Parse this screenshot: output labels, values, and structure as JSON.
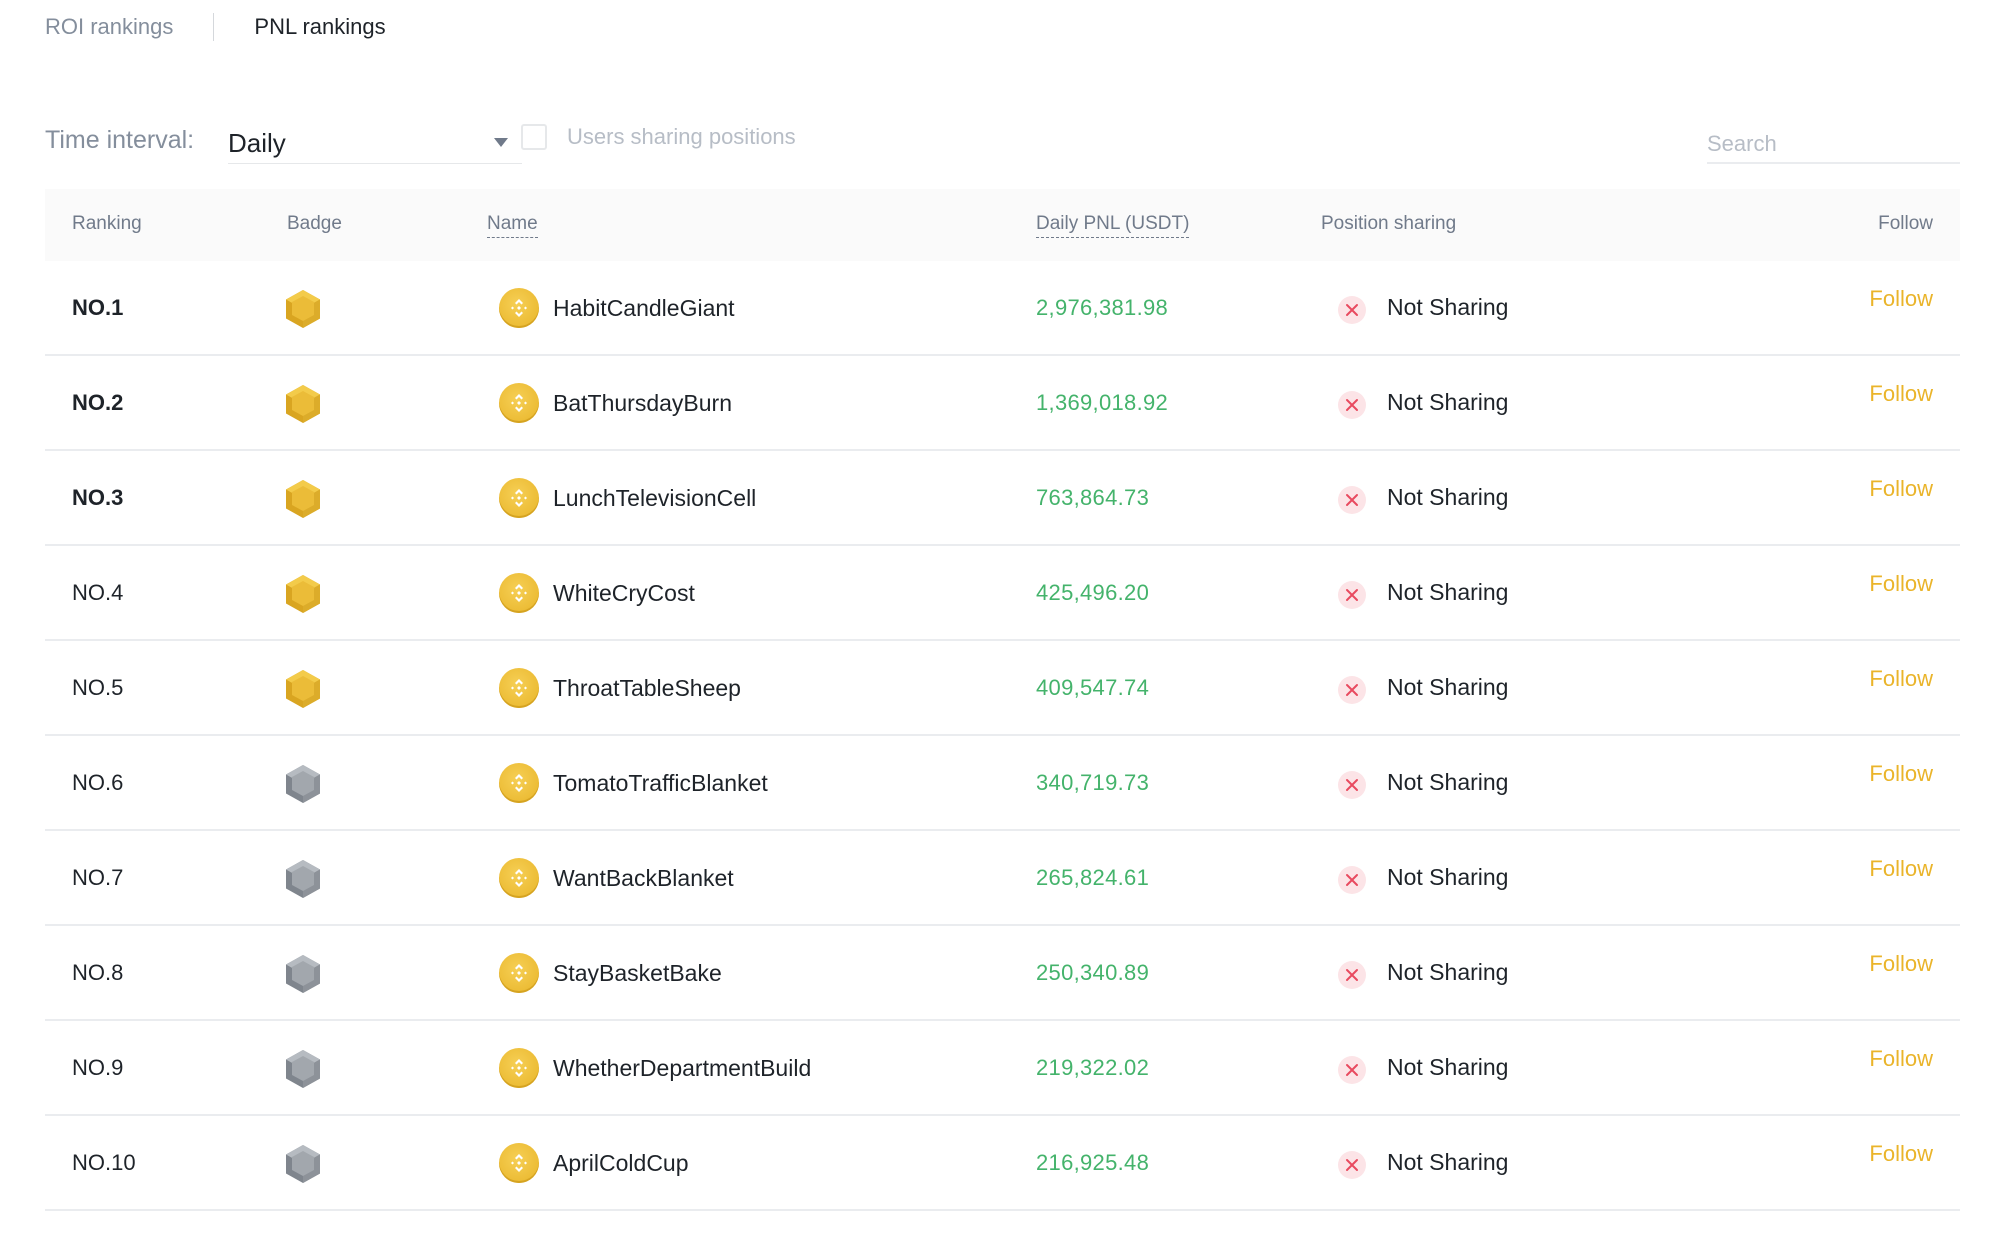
{
  "tabs": [
    {
      "label": "ROI rankings",
      "active": false
    },
    {
      "label": "PNL rankings",
      "active": true
    }
  ],
  "filters": {
    "time_interval_label": "Time interval:",
    "time_interval_value": "Daily",
    "sharing_checkbox_label": "Users sharing positions",
    "sharing_checkbox_checked": false,
    "search_placeholder": "Search",
    "search_value": ""
  },
  "table": {
    "headers": {
      "ranking": "Ranking",
      "badge": "Badge",
      "name": "Name",
      "pnl": "Daily PNL (USDT)",
      "position_sharing": "Position sharing",
      "follow": "Follow"
    },
    "rows": [
      {
        "rank": "NO.1",
        "badge": "gold",
        "name": "HabitCandleGiant",
        "pnl": "2,976,381.98",
        "sharing": "Not Sharing",
        "follow": "Follow"
      },
      {
        "rank": "NO.2",
        "badge": "gold",
        "name": "BatThursdayBurn",
        "pnl": "1,369,018.92",
        "sharing": "Not Sharing",
        "follow": "Follow"
      },
      {
        "rank": "NO.3",
        "badge": "gold",
        "name": "LunchTelevisionCell",
        "pnl": "763,864.73",
        "sharing": "Not Sharing",
        "follow": "Follow"
      },
      {
        "rank": "NO.4",
        "badge": "gold",
        "name": "WhiteCryCost",
        "pnl": "425,496.20",
        "sharing": "Not Sharing",
        "follow": "Follow"
      },
      {
        "rank": "NO.5",
        "badge": "gold",
        "name": "ThroatTableSheep",
        "pnl": "409,547.74",
        "sharing": "Not Sharing",
        "follow": "Follow"
      },
      {
        "rank": "NO.6",
        "badge": "silver",
        "name": "TomatoTrafficBlanket",
        "pnl": "340,719.73",
        "sharing": "Not Sharing",
        "follow": "Follow"
      },
      {
        "rank": "NO.7",
        "badge": "silver",
        "name": "WantBackBlanket",
        "pnl": "265,824.61",
        "sharing": "Not Sharing",
        "follow": "Follow"
      },
      {
        "rank": "NO.8",
        "badge": "silver",
        "name": "StayBasketBake",
        "pnl": "250,340.89",
        "sharing": "Not Sharing",
        "follow": "Follow"
      },
      {
        "rank": "NO.9",
        "badge": "silver",
        "name": "WhetherDepartmentBuild",
        "pnl": "219,322.02",
        "sharing": "Not Sharing",
        "follow": "Follow"
      },
      {
        "rank": "NO.10",
        "badge": "silver",
        "name": "AprilColdCup",
        "pnl": "216,925.48",
        "sharing": "Not Sharing",
        "follow": "Follow"
      }
    ]
  },
  "icons": {
    "gold_badge": "hexagon-gold-badge-icon",
    "silver_badge": "hexagon-silver-badge-icon",
    "avatar": "bnb-coin-icon",
    "not_sharing": "x-circle-icon",
    "dropdown": "caret-down-icon"
  },
  "colors": {
    "pnl_positive": "#44b36b",
    "follow": "#eab42a",
    "not_sharing_icon": "#e84a5f",
    "gold_badge": "#ecbc35",
    "silver_badge": "#9ea3aa"
  }
}
